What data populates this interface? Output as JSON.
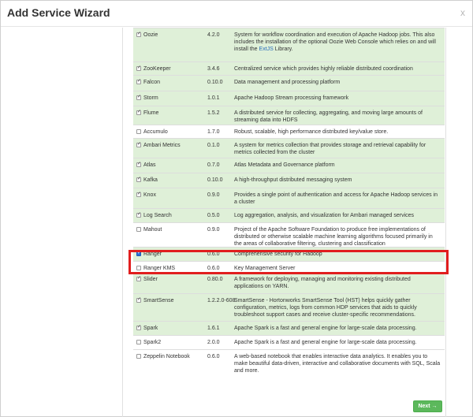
{
  "dialog": {
    "title": "Add Service Wizard",
    "close_label": "x"
  },
  "footer": {
    "next_label": "Next →"
  },
  "services": [
    {
      "name": "Oozie",
      "version": "4.2.0",
      "description": "System for workflow coordination and execution of Apache Hadoop jobs. This also includes the installation of the optional Oozie Web Console which relies on and will install the",
      "link": "ExtJS",
      "description_tail": " Library.",
      "checked": true
    },
    {
      "name": "ZooKeeper",
      "version": "3.4.6",
      "description": "Centralized service which provides highly reliable distributed coordination",
      "checked": true
    },
    {
      "name": "Falcon",
      "version": "0.10.0",
      "description": "Data management and processing platform",
      "checked": true
    },
    {
      "name": "Storm",
      "version": "1.0.1",
      "description": "Apache Hadoop Stream processing framework",
      "checked": true
    },
    {
      "name": "Flume",
      "version": "1.5.2",
      "description": "A distributed service for collecting, aggregating, and moving large amounts of streaming data into HDFS",
      "checked": true
    },
    {
      "name": "Accumulo",
      "version": "1.7.0",
      "description": "Robust, scalable, high performance distributed key/value store.",
      "checked": false
    },
    {
      "name": "Ambari Metrics",
      "version": "0.1.0",
      "description": "A system for metrics collection that provides storage and retrieval capability for metrics collected from the cluster",
      "checked": true
    },
    {
      "name": "Atlas",
      "version": "0.7.0",
      "description": "Atlas Metadata and Governance platform",
      "checked": true
    },
    {
      "name": "Kafka",
      "version": "0.10.0",
      "description": "A high-throughput distributed messaging system",
      "checked": true
    },
    {
      "name": "Knox",
      "version": "0.9.0",
      "description": "Provides a single point of authentication and access for Apache Hadoop services in a cluster",
      "checked": true
    },
    {
      "name": "Log Search",
      "version": "0.5.0",
      "description": "Log aggregation, analysis, and visualization for Ambari managed services",
      "checked": true
    },
    {
      "name": "Mahout",
      "version": "0.9.0",
      "description": "Project of the Apache Software Foundation to produce free implementations of distributed or otherwise scalable machine learning algorithms focused primarily in the areas of collaborative filtering, clustering and classification",
      "checked": false
    },
    {
      "name": "Ranger",
      "version": "0.6.0",
      "description": "Comprehensive security for Hadoop",
      "checked": true
    },
    {
      "name": "Ranger KMS",
      "version": "0.6.0",
      "description": "Key Management Server",
      "checked": false
    },
    {
      "name": "Slider",
      "version": "0.80.0",
      "description": "A framework for deploying, managing and monitoring existing distributed applications on YARN.",
      "checked": true
    },
    {
      "name": "SmartSense",
      "version": "1.2.2.0-608",
      "description": "SmartSense - Hortonworks SmartSense Tool (HST) helps quickly gather configuration, metrics, logs from common HDP services that aids to quickly troubleshoot support cases and receive cluster-specific recommendations.",
      "checked": true
    },
    {
      "name": "Spark",
      "version": "1.6.1",
      "description": "Apache Spark is a fast and general engine for large-scale data processing.",
      "checked": true
    },
    {
      "name": "Spark2",
      "version": "2.0.0",
      "description": "Apache Spark is a fast and general engine for large-scale data processing.",
      "checked": false
    },
    {
      "name": "Zeppelin Notebook",
      "version": "0.6.0",
      "description": "A web-based notebook that enables interactive data analytics. It enables you to make beautiful data-driven, interactive and collaborative documents with SQL, Scala and more.",
      "checked": false
    }
  ]
}
